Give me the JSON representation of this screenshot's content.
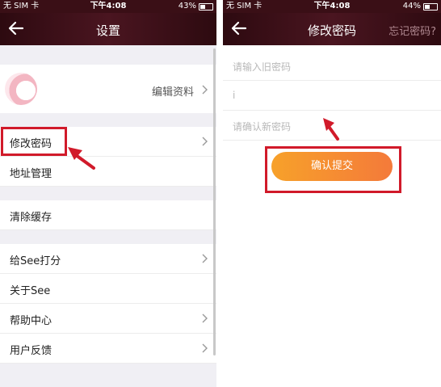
{
  "left_screen": {
    "status": {
      "carrier": "无 SIM 卡",
      "time": "下午4:08",
      "battery": "43%",
      "battery_level": 0.43
    },
    "nav": {
      "title": "设置"
    },
    "profile": {
      "edit_label": "编辑资料"
    },
    "rows": {
      "change_password": "修改密码",
      "address": "地址管理",
      "clear_cache": "清除缓存",
      "rate": "给See打分",
      "about": "关于See",
      "help": "帮助中心",
      "feedback": "用户反馈"
    }
  },
  "right_screen": {
    "status": {
      "carrier": "无 SIM 卡",
      "time": "下午4:08",
      "battery": "44%",
      "battery_level": 0.44
    },
    "nav": {
      "title": "修改密码",
      "forgot_label": "忘记密码?"
    },
    "inputs": {
      "old_password_placeholder": "请输入旧密码",
      "new_password_placeholder": "i",
      "confirm_password_placeholder": "请确认新密码"
    },
    "submit_label": "确认提交"
  },
  "colors": {
    "navbar": "#3a0f16",
    "highlight": "#d11a2a",
    "button_start": "#f7a12a",
    "button_end": "#f47a3a"
  }
}
